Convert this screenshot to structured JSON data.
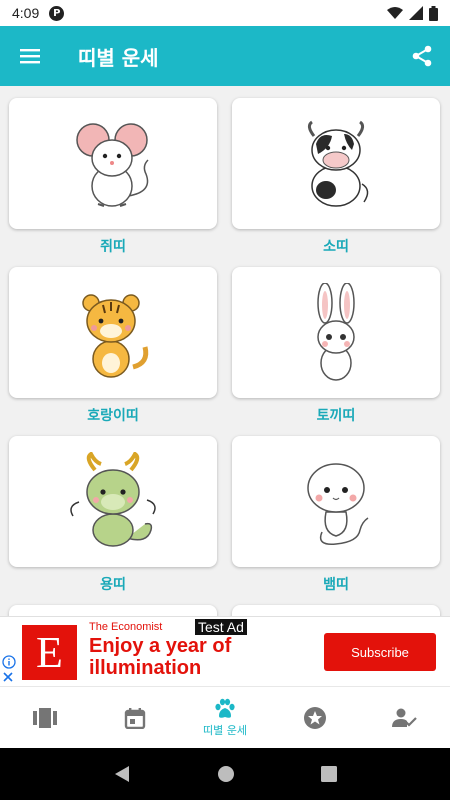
{
  "status_bar": {
    "time": "4:09",
    "app_icon_letter": "P"
  },
  "app_bar": {
    "title": "띠별 운세",
    "menu_icon": "menu-icon",
    "share_icon": "share-icon"
  },
  "zodiac": [
    {
      "label": "쥐띠",
      "icon": "rat-icon"
    },
    {
      "label": "소띠",
      "icon": "ox-icon"
    },
    {
      "label": "호랑이띠",
      "icon": "tiger-icon"
    },
    {
      "label": "토끼띠",
      "icon": "rabbit-icon"
    },
    {
      "label": "용띠",
      "icon": "dragon-icon"
    },
    {
      "label": "뱀띠",
      "icon": "snake-icon"
    }
  ],
  "ad": {
    "logo_letter": "E",
    "brand": "The Economist",
    "headline": "Enjoy a year of illumination",
    "test_badge": "Test Ad",
    "cta": "Subscribe",
    "brand_color": "#e3120b"
  },
  "bottom_nav": {
    "items": [
      {
        "icon": "cards-icon",
        "label": ""
      },
      {
        "icon": "calendar-icon",
        "label": ""
      },
      {
        "icon": "paw-icon",
        "label": "띠별 운세",
        "active": true
      },
      {
        "icon": "star-icon",
        "label": ""
      },
      {
        "icon": "person-check-icon",
        "label": ""
      }
    ]
  },
  "colors": {
    "primary": "#1cb8c7",
    "label": "#1aa9b8",
    "inactive": "#757575"
  }
}
